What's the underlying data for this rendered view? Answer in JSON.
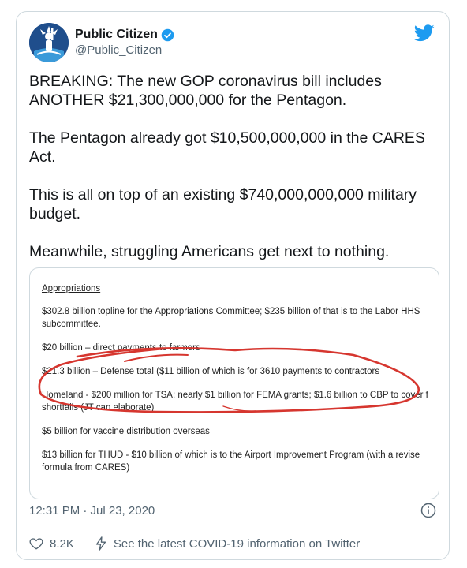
{
  "tweet": {
    "name": "Public Citizen",
    "handle": "@Public_Citizen",
    "paragraphs": [
      "BREAKING: The new GOP coronavirus bill includes ANOTHER $21,300,000,000 for the Pentagon.",
      "The Pentagon already got $10,500,000,000 in the CARES Act.",
      "This is all on top of an existing $740,000,000,000 military budget.",
      "Meanwhile, struggling Americans get next to nothing."
    ],
    "timestamp": "12:31 PM · Jul 23, 2020",
    "likes": "8.2K",
    "covid_link": "See the latest COVID-19 information on Twitter"
  },
  "document": {
    "heading": "Appropriations",
    "lines": [
      "$302.8 billion topline for the Appropriations Committee;  $235 billion of that is to the Labor HHS",
      "subcommittee.",
      "$20 billion – direct payments to farmers",
      "$21.3 billion – Defense total ($11 billion of which is for 3610 payments to contractors",
      "Homeland - $200 million for TSA; nearly $1 billion for FEMA grants; $1.6 billion to CBP to cover f",
      "shortfalls (JT can elaborate)",
      "$5 billion for vaccine distribution overseas",
      "$13 billion for THUD - $10 billion of which is to the Airport Improvement Program (with a revise",
      "formula from CARES)"
    ]
  },
  "colors": {
    "accent": "#1d9bf0",
    "annotation": "#d6362f",
    "muted": "#536471"
  },
  "icons": [
    "public-citizen-logo-icon",
    "verified-badge-icon",
    "twitter-bird-icon",
    "info-icon",
    "heart-icon",
    "lightning-icon"
  ]
}
